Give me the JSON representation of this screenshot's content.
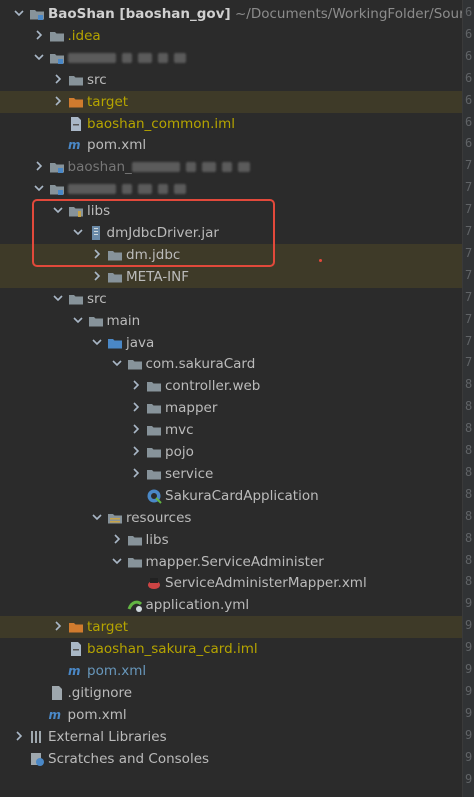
{
  "tree": [
    {
      "key": "root",
      "indent": 0,
      "arrow": "down",
      "icon": "folder-module",
      "label": "BaoShan",
      "bold": true,
      "extra": " [baoshan_gov]",
      "suffix": " ~/Documents/WorkingFolder/Sourc",
      "cls": "bold"
    },
    {
      "key": "idea",
      "indent": 1,
      "arrow": "right",
      "icon": "folder",
      "label": ".idea",
      "cls": "yellow"
    },
    {
      "key": "module1",
      "indent": 1,
      "arrow": "down",
      "icon": "folder-module",
      "label": "",
      "cls": "blur"
    },
    {
      "key": "src1",
      "indent": 2,
      "arrow": "right",
      "icon": "folder",
      "label": "src",
      "cls": ""
    },
    {
      "key": "target1",
      "indent": 2,
      "arrow": "right",
      "icon": "folder-orange",
      "label": "target",
      "cls": "yellow",
      "hl": true
    },
    {
      "key": "iml1",
      "indent": 2,
      "arrow": "none",
      "icon": "file-iml",
      "label": "baoshan_common.iml",
      "cls": "yellow"
    },
    {
      "key": "pom1",
      "indent": 2,
      "arrow": "none",
      "icon": "maven",
      "label": "pom.xml",
      "cls": ""
    },
    {
      "key": "module2",
      "indent": 1,
      "arrow": "right",
      "icon": "folder-module",
      "label": "baoshan_",
      "cls": "blur"
    },
    {
      "key": "module3",
      "indent": 1,
      "arrow": "down",
      "icon": "folder-module",
      "label": "",
      "cls": "blur"
    },
    {
      "key": "libs",
      "indent": 2,
      "arrow": "down",
      "icon": "folder-lib",
      "label": "libs",
      "cls": ""
    },
    {
      "key": "jar",
      "indent": 3,
      "arrow": "down",
      "icon": "jar",
      "label": "dmJdbcDriver.jar",
      "cls": ""
    },
    {
      "key": "dmjdbc",
      "indent": 4,
      "arrow": "right",
      "icon": "folder",
      "label": "dm.jdbc",
      "cls": "",
      "hl": true
    },
    {
      "key": "metainf",
      "indent": 4,
      "arrow": "right",
      "icon": "folder",
      "label": "META-INF",
      "cls": "",
      "hl": true
    },
    {
      "key": "src3",
      "indent": 2,
      "arrow": "down",
      "icon": "folder",
      "label": "src",
      "cls": ""
    },
    {
      "key": "main",
      "indent": 3,
      "arrow": "down",
      "icon": "folder",
      "label": "main",
      "cls": ""
    },
    {
      "key": "java",
      "indent": 4,
      "arrow": "down",
      "icon": "folder-blue",
      "label": "java",
      "cls": ""
    },
    {
      "key": "pkg",
      "indent": 5,
      "arrow": "down",
      "icon": "folder",
      "label": "com.sakuraCard",
      "cls": ""
    },
    {
      "key": "controller",
      "indent": 6,
      "arrow": "right",
      "icon": "folder",
      "label": "controller.web",
      "cls": ""
    },
    {
      "key": "mapper",
      "indent": 6,
      "arrow": "right",
      "icon": "folder",
      "label": "mapper",
      "cls": ""
    },
    {
      "key": "mvc",
      "indent": 6,
      "arrow": "right",
      "icon": "folder",
      "label": "mvc",
      "cls": ""
    },
    {
      "key": "pojo",
      "indent": 6,
      "arrow": "right",
      "icon": "folder",
      "label": "pojo",
      "cls": ""
    },
    {
      "key": "service",
      "indent": 6,
      "arrow": "right",
      "icon": "folder",
      "label": "service",
      "cls": ""
    },
    {
      "key": "app",
      "indent": 6,
      "arrow": "none",
      "icon": "spring-class",
      "label": "SakuraCardApplication",
      "cls": ""
    },
    {
      "key": "resources",
      "indent": 4,
      "arrow": "down",
      "icon": "folder-res",
      "label": "resources",
      "cls": ""
    },
    {
      "key": "reslibs",
      "indent": 5,
      "arrow": "right",
      "icon": "folder",
      "label": "libs",
      "cls": ""
    },
    {
      "key": "mapperdir",
      "indent": 5,
      "arrow": "down",
      "icon": "folder",
      "label": "mapper.ServiceAdminister",
      "cls": ""
    },
    {
      "key": "mapperxml",
      "indent": 6,
      "arrow": "none",
      "icon": "mybatis",
      "label": "ServiceAdministerMapper.xml",
      "cls": ""
    },
    {
      "key": "appyml",
      "indent": 5,
      "arrow": "none",
      "icon": "yml",
      "label": "application.yml",
      "cls": ""
    },
    {
      "key": "target3",
      "indent": 2,
      "arrow": "right",
      "icon": "folder-orange",
      "label": "target",
      "cls": "yellow",
      "hl": true
    },
    {
      "key": "iml3",
      "indent": 2,
      "arrow": "none",
      "icon": "file-iml",
      "label": "baoshan_sakura_card.iml",
      "cls": "yellow"
    },
    {
      "key": "pom3",
      "indent": 2,
      "arrow": "none",
      "icon": "maven",
      "label": "pom.xml",
      "cls": "blue"
    },
    {
      "key": "gitignore",
      "indent": 1,
      "arrow": "none",
      "icon": "file",
      "label": ".gitignore",
      "cls": ""
    },
    {
      "key": "pomroot",
      "indent": 1,
      "arrow": "none",
      "icon": "maven",
      "label": "pom.xml",
      "cls": ""
    },
    {
      "key": "extlibs",
      "indent": 0,
      "arrow": "right",
      "icon": "ext-libs",
      "label": "External Libraries",
      "cls": ""
    },
    {
      "key": "scratches",
      "indent": 0,
      "arrow": "none",
      "icon": "scratches",
      "label": "Scratches and Consoles",
      "cls": ""
    }
  ],
  "gutter_numbers": [
    "6",
    "6",
    "6",
    "6",
    "6",
    "6",
    "6",
    "7",
    "7",
    "7",
    "7",
    "7",
    "7",
    "7",
    "7",
    "7",
    "7",
    "8",
    "8",
    "8",
    "8",
    "8",
    "8",
    "8",
    "8",
    "8",
    "8",
    "9",
    "9",
    "9",
    "9",
    "9",
    "9",
    "9",
    "9",
    "9"
  ],
  "colors": {
    "background": "#2b2b2b",
    "text": "#bbbbbb",
    "excluded": "#b5a400",
    "highlight_box": "#e2493b"
  }
}
